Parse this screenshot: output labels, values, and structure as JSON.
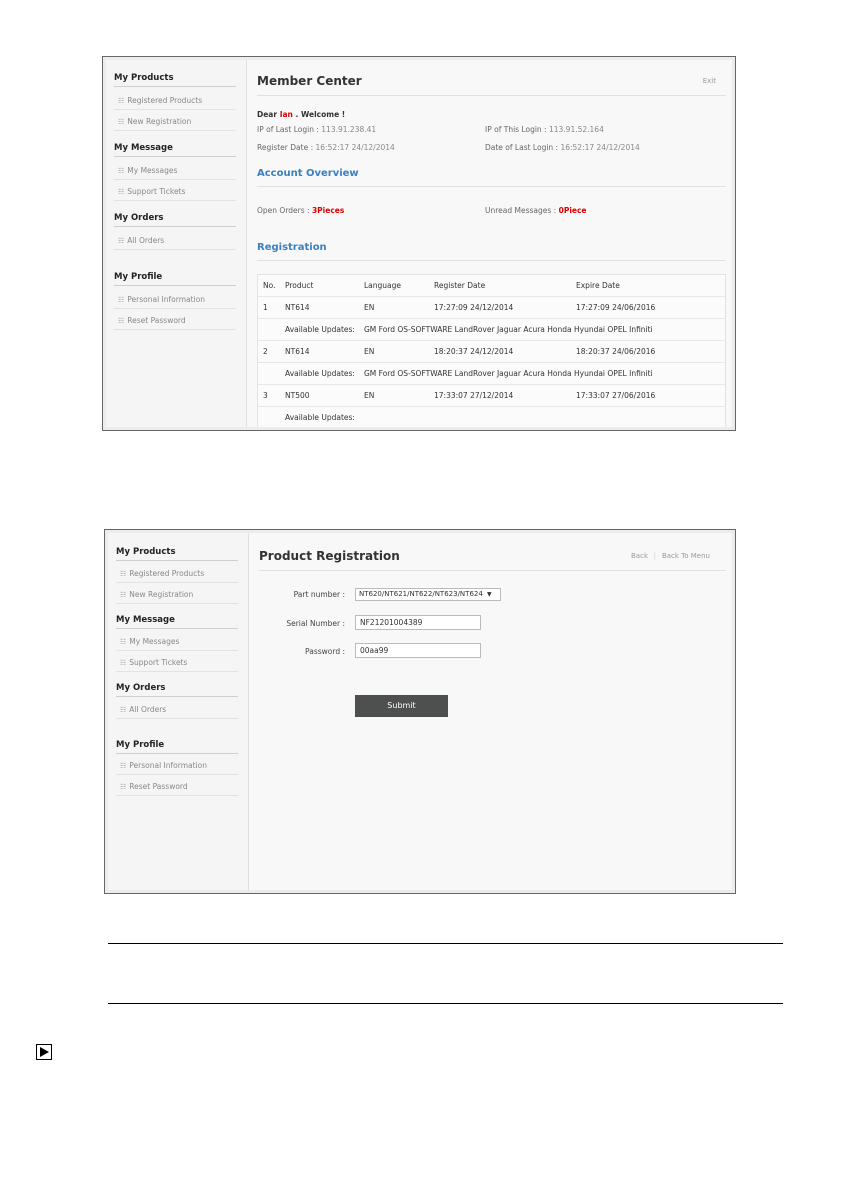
{
  "screen1": {
    "sidebar": {
      "sections": [
        {
          "title": "My Products",
          "items": [
            "Registered Products",
            "New Registration"
          ]
        },
        {
          "title": "My Message",
          "items": [
            "My Messages",
            "Support Tickets"
          ]
        },
        {
          "title": "My Orders",
          "items": [
            "All Orders"
          ]
        },
        {
          "title": "My Profile",
          "items": [
            "Personal Information",
            "Reset Password"
          ]
        }
      ]
    },
    "title": "Member Center",
    "exit_label": "Exit",
    "greeting_prefix": "Dear",
    "user_name": "Ian",
    "greeting_suffix": ". Welcome !",
    "ip_last_label": "IP of Last Login :",
    "ip_last_value": "113.91.238.41",
    "ip_this_label": "IP of This Login :",
    "ip_this_value": "113.91.52.164",
    "register_date_label": "Register Date :",
    "register_date_value": "16:52:17 24/12/2014",
    "last_login_label": "Date of Last Login :",
    "last_login_value": "16:52:17 24/12/2014",
    "account_overview_title": "Account Overview",
    "open_orders_label": "Open Orders :",
    "open_orders_value": "3Pieces",
    "unread_label": "Unread Messages :",
    "unread_value": "0Piece",
    "registration_title": "Registration",
    "table": {
      "headers": [
        "No.",
        "Product",
        "Language",
        "Register Date",
        "Expire Date"
      ],
      "updates_label": "Available Updates:",
      "rows": [
        {
          "no": "1",
          "product": "NT614",
          "language": "EN",
          "register": "17:27:09 24/12/2014",
          "expire": "17:27:09 24/06/2016",
          "updates": "GM Ford OS-SOFTWARE LandRover Jaguar Acura Honda Hyundai OPEL Infiniti"
        },
        {
          "no": "2",
          "product": "NT614",
          "language": "EN",
          "register": "18:20:37 24/12/2014",
          "expire": "18:20:37 24/06/2016",
          "updates": "GM Ford OS-SOFTWARE LandRover Jaguar Acura Honda Hyundai OPEL Infiniti"
        },
        {
          "no": "3",
          "product": "NT500",
          "language": "EN",
          "register": "17:33:07 27/12/2014",
          "expire": "17:33:07 27/06/2016",
          "updates": ""
        }
      ]
    }
  },
  "screen2": {
    "sidebar": {
      "sections": [
        {
          "title": "My Products",
          "items": [
            "Registered Products",
            "New Registration"
          ]
        },
        {
          "title": "My Message",
          "items": [
            "My Messages",
            "Support Tickets"
          ]
        },
        {
          "title": "My Orders",
          "items": [
            "All Orders"
          ]
        },
        {
          "title": "My Profile",
          "items": [
            "Personal Information",
            "Reset Password"
          ]
        }
      ]
    },
    "title": "Product Registration",
    "back_label": "Back",
    "back_menu_label": "Back To Menu",
    "separator": "|",
    "part_number_label": "Part number :",
    "part_number_value": "NT620/NT621/NT622/NT623/NT624",
    "serial_label": "Serial Number :",
    "serial_value": "NF21201004389",
    "password_label": "Password :",
    "password_value": "00aa99",
    "submit_label": "Submit"
  },
  "icons": {
    "list": "☷",
    "play": "▶"
  }
}
